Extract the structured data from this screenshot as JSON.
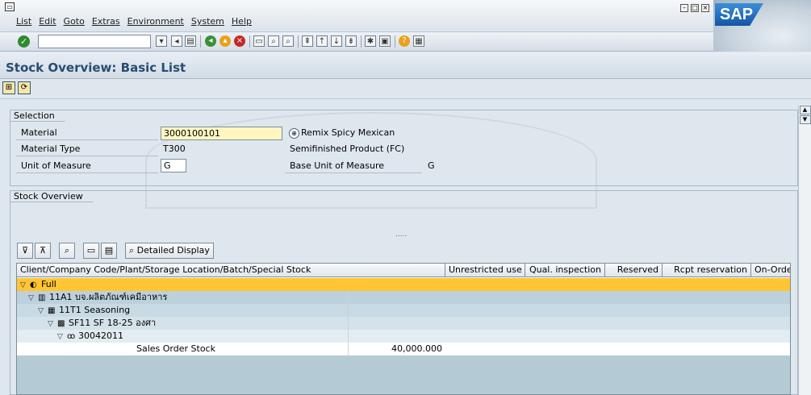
{
  "menu": [
    "List",
    "Edit",
    "Goto",
    "Extras",
    "Environment",
    "System",
    "Help"
  ],
  "window_controls": [
    "minimize",
    "maximize",
    "close"
  ],
  "logo": "SAP",
  "command_field": "",
  "title": "Stock Overview: Basic List",
  "selection": {
    "title": "Selection",
    "material_label": "Material",
    "material_value": "3000100101",
    "material_desc": "Remix Spicy Mexican",
    "material_type_label": "Material Type",
    "material_type_value": "T300",
    "material_type_desc": "Semifinished Product (FC)",
    "uom_label": "Unit of Measure",
    "uom_value": "G",
    "base_uom_label": "Base Unit of Measure",
    "base_uom_value": "G"
  },
  "stock": {
    "title": "Stock Overview",
    "dots": ".....",
    "detailed_display": "Detailed Display",
    "columns": [
      "Client/Company Code/Plant/Storage Location/Batch/Special Stock",
      "Unrestricted use",
      "Qual. inspection",
      "Reserved",
      "Rcpt reservation",
      "On-Order Stock"
    ],
    "rows": [
      {
        "label": "Full",
        "icon": "client-icon",
        "unrestricted": ""
      },
      {
        "label": "11A1 บจ.ผลิตภัณฑ์เคมีอาหาร",
        "icon": "company-icon",
        "unrestricted": ""
      },
      {
        "label": "11T1 Seasoning",
        "icon": "plant-icon",
        "unrestricted": ""
      },
      {
        "label": "SF11 SF 18-25 องศา",
        "icon": "storage-icon",
        "unrestricted": ""
      },
      {
        "label": "30042011",
        "icon": "batch-icon",
        "unrestricted": ""
      },
      {
        "label": "Sales Order Stock",
        "icon": "",
        "unrestricted": "40,000.000"
      }
    ]
  },
  "colors": {
    "background": "#dfe7ee",
    "highlight": "#ffc532",
    "active_field": "#fff6c0",
    "title_text": "#274d73"
  }
}
